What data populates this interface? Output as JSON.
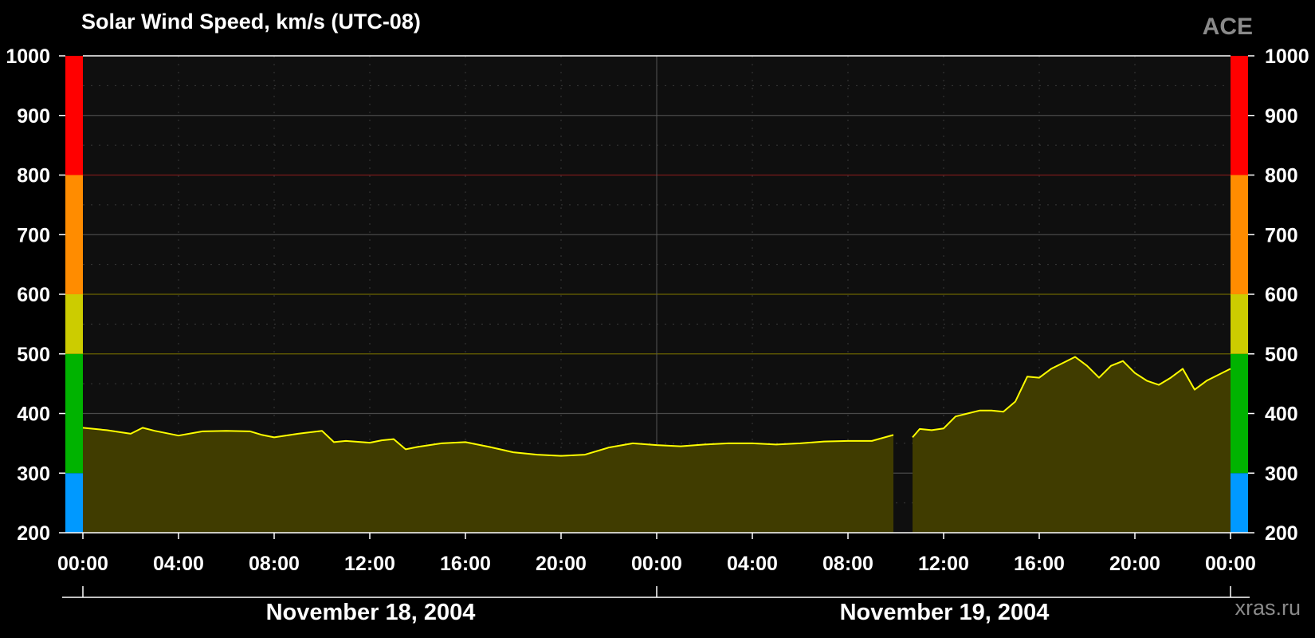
{
  "chart_data": {
    "type": "area",
    "title": "Solar Wind Speed, km/s (UTC-08)",
    "source_label": "ACE",
    "credit": "xras.ru",
    "ylim": [
      200,
      1000
    ],
    "yticks": [
      200,
      300,
      400,
      500,
      600,
      700,
      800,
      900,
      1000
    ],
    "x_range_hours": [
      0,
      48
    ],
    "x_tick_labels": [
      "00:00",
      "04:00",
      "08:00",
      "12:00",
      "16:00",
      "20:00",
      "00:00",
      "04:00",
      "08:00",
      "12:00",
      "16:00",
      "20:00",
      "00:00"
    ],
    "date_labels": [
      "November 18, 2004",
      "November 19, 2004"
    ],
    "grid": true,
    "colors": {
      "background": "#0f0f0f",
      "line": "#ffff00",
      "fill": "#403c00",
      "band_blue": "#0099ff",
      "band_green": "#00b300",
      "band_yellow": "#cccc00",
      "band_orange": "#ff8c00",
      "band_red": "#ff0000"
    },
    "threshold_bands": [
      {
        "from": 200,
        "to": 300,
        "color": "#0099ff"
      },
      {
        "from": 300,
        "to": 500,
        "color": "#00b300"
      },
      {
        "from": 500,
        "to": 600,
        "color": "#cccc00"
      },
      {
        "from": 600,
        "to": 800,
        "color": "#ff8c00"
      },
      {
        "from": 800,
        "to": 1000,
        "color": "#ff0000"
      }
    ],
    "series": [
      {
        "x": [
          0,
          1,
          2,
          2.5,
          3,
          4,
          5,
          6,
          7,
          7.5,
          8,
          9,
          10,
          10.5,
          11,
          12,
          12.5,
          13,
          13.5,
          14,
          15,
          16,
          17,
          18,
          19,
          20,
          21,
          22,
          23,
          24,
          25,
          26,
          27,
          28,
          29,
          30,
          31,
          32,
          33,
          33.9
        ],
        "values": [
          376,
          372,
          366,
          376,
          371,
          363,
          370,
          371,
          370,
          364,
          360,
          366,
          371,
          352,
          354,
          351,
          355,
          357,
          340,
          344,
          350,
          352,
          344,
          335,
          331,
          329,
          331,
          343,
          350,
          347,
          345,
          348,
          350,
          350,
          348,
          350,
          353,
          354,
          354,
          364
        ]
      },
      {
        "x": [
          34.7,
          35,
          35.5,
          36,
          36.5,
          37,
          37.5,
          38,
          38.5,
          39,
          39.5,
          40,
          40.5,
          41,
          41.5,
          42,
          42.5,
          43,
          43.5,
          44,
          44.5,
          45,
          45.5,
          46,
          46.5,
          47,
          47.5,
          48
        ],
        "values": [
          360,
          374,
          372,
          375,
          395,
          400,
          405,
          405,
          403,
          420,
          462,
          460,
          475,
          485,
          495,
          480,
          460,
          480,
          488,
          468,
          455,
          448,
          460,
          475,
          440,
          455,
          465,
          475
        ]
      }
    ]
  }
}
